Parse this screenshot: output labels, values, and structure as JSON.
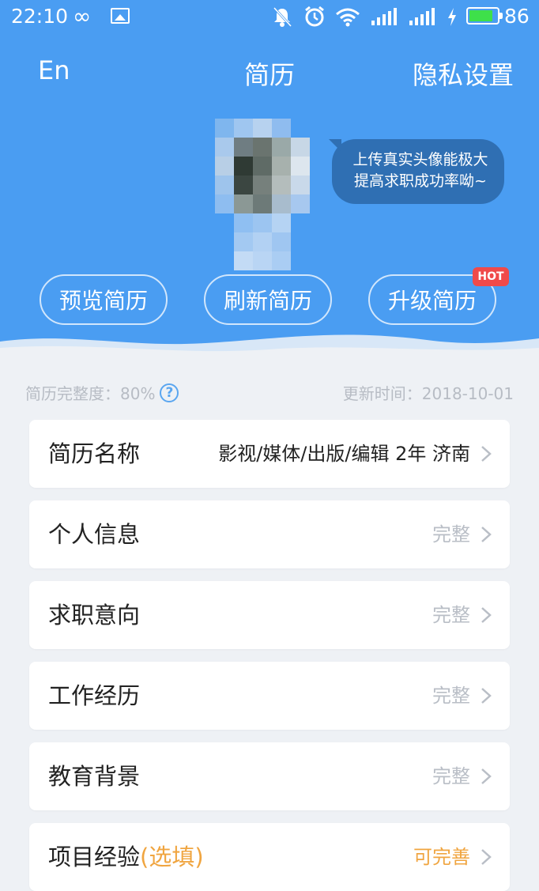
{
  "status_bar": {
    "time": "22:10",
    "battery_percent": "86",
    "battery_level": 0.86,
    "icons": [
      "infinity-icon",
      "image-icon",
      "mute-icon",
      "alarm-icon",
      "wifi-icon",
      "signal-icon",
      "signal-icon",
      "charging-icon",
      "battery-icon"
    ]
  },
  "nav": {
    "lang": "En",
    "title": "简历",
    "privacy": "隐私设置"
  },
  "avatar": {
    "icon": "avatar-pixelated"
  },
  "tooltip": {
    "line1": "上传真实头像能极大",
    "line2": "提高求职成功率呦~"
  },
  "actions": {
    "preview": "预览简历",
    "refresh": "刷新简历",
    "upgrade": "升级简历",
    "hot": "HOT"
  },
  "meta": {
    "completeness": "简历完整度：80%",
    "help_icon": "?",
    "updated": "更新时间：2018-10-01"
  },
  "sections": [
    {
      "label": "简历名称",
      "value": "影视/媒体/出版/编辑 2年 济南"
    },
    {
      "label": "个人信息",
      "value": "完整"
    },
    {
      "label": "求职意向",
      "value": "完整"
    },
    {
      "label": "工作经历",
      "value": "完整"
    },
    {
      "label": "教育背景",
      "value": "完整"
    },
    {
      "label": "项目经验",
      "label_suffix": "(选填)",
      "value": "可完善"
    }
  ],
  "colors": {
    "hero_blue": "#4a9df2",
    "bubble": "#2f6fb3",
    "hot_red": "#f04a4a",
    "optional_orange": "#f0a540",
    "background": "#eef1f5"
  }
}
